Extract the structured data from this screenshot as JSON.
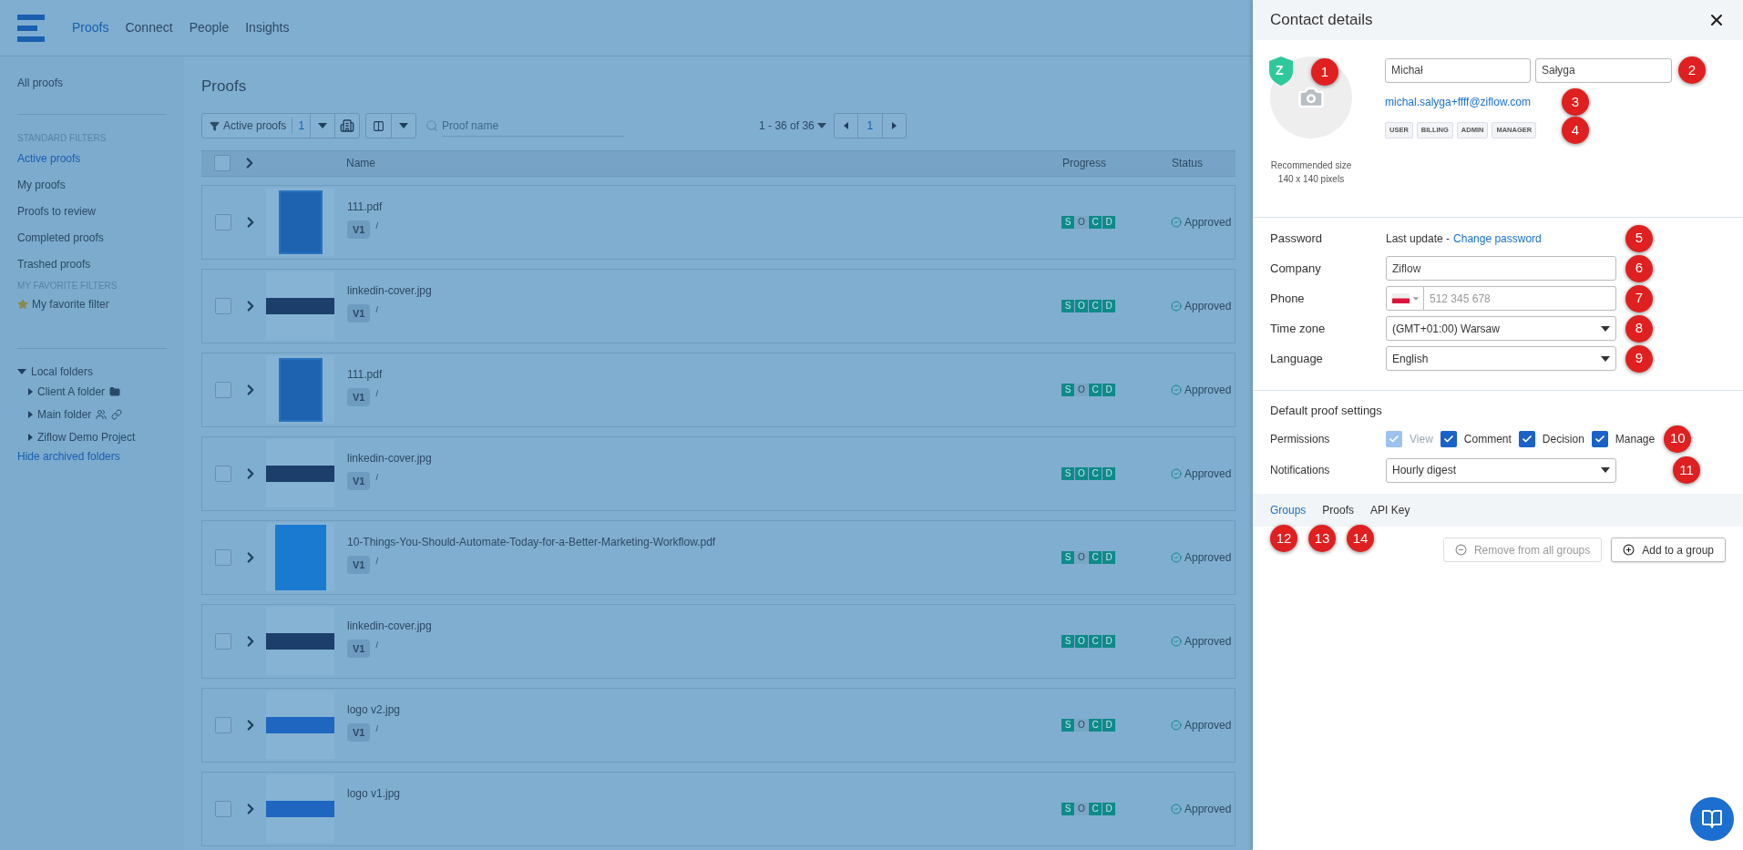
{
  "nav": {
    "items": [
      {
        "label": "Proofs",
        "selected": true
      },
      {
        "label": "Connect",
        "selected": false
      },
      {
        "label": "People",
        "selected": false
      },
      {
        "label": "Insights",
        "selected": false
      }
    ]
  },
  "sidebar": {
    "all_proofs": "All proofs",
    "standard_heading": "STANDARD FILTERS",
    "standard_items": [
      {
        "label": "Active proofs",
        "selected": true
      },
      {
        "label": "My proofs",
        "selected": false
      },
      {
        "label": "Proofs to review",
        "selected": false
      },
      {
        "label": "Completed proofs",
        "selected": false
      },
      {
        "label": "Trashed proofs",
        "selected": false
      }
    ],
    "favorite_heading": "MY FAVORITE FILTERS",
    "favorite_items": [
      {
        "label": "My favorite filter"
      }
    ],
    "folders": {
      "label": "Local folders",
      "expanded": true,
      "children": [
        {
          "label": "Client A folder",
          "kind": "client"
        },
        {
          "label": "Main folder",
          "kind": "shared"
        },
        {
          "label": "Ziflow Demo Project",
          "kind": "plain"
        }
      ]
    },
    "hide_archived": "Hide archived folders"
  },
  "main": {
    "title": "Proofs",
    "select_all": {
      "checked": false
    },
    "filter": {
      "label": "Active proofs",
      "count": "1"
    },
    "search": {
      "placeholder": "Proof name"
    },
    "pagination": {
      "range": "1 - 36 of 36",
      "page": "1"
    },
    "columns": [
      "Name",
      "Progress",
      "Status"
    ],
    "rows": [
      {
        "name": "111.pdf",
        "version": "V1",
        "path": "/",
        "checked": false,
        "kind": "poster",
        "steps": [
          {
            "letter": "S",
            "done": true
          },
          {
            "letter": "O",
            "done": false
          },
          {
            "letter": "C",
            "done": true
          },
          {
            "letter": "D",
            "done": true
          }
        ],
        "status": "Approved"
      },
      {
        "name": "linkedin-cover.jpg",
        "version": "V1",
        "path": "/",
        "checked": false,
        "kind": "banner",
        "steps": [
          {
            "letter": "S",
            "done": true
          },
          {
            "letter": "O",
            "done": true
          },
          {
            "letter": "C",
            "done": true
          },
          {
            "letter": "D",
            "done": true
          }
        ],
        "status": "Approved"
      },
      {
        "name": "111.pdf",
        "version": "V1",
        "path": "/",
        "checked": false,
        "kind": "poster",
        "steps": [
          {
            "letter": "S",
            "done": true
          },
          {
            "letter": "O",
            "done": false
          },
          {
            "letter": "C",
            "done": true
          },
          {
            "letter": "D",
            "done": true
          }
        ],
        "status": "Approved"
      },
      {
        "name": "linkedin-cover.jpg",
        "version": "V1",
        "path": "/",
        "checked": false,
        "kind": "banner",
        "steps": [
          {
            "letter": "S",
            "done": true
          },
          {
            "letter": "O",
            "done": true
          },
          {
            "letter": "C",
            "done": true
          },
          {
            "letter": "D",
            "done": true
          }
        ],
        "status": "Approved"
      },
      {
        "name": "10-Things-You-Should-Automate-Today-for-a-Better-Marketing-Workflow.pdf",
        "version": "V1",
        "path": "/",
        "checked": false,
        "kind": "ebook",
        "steps": [
          {
            "letter": "S",
            "done": true
          },
          {
            "letter": "O",
            "done": false
          },
          {
            "letter": "C",
            "done": true
          },
          {
            "letter": "D",
            "done": true
          }
        ],
        "status": "Approved"
      },
      {
        "name": "linkedin-cover.jpg",
        "version": "V1",
        "path": "/",
        "checked": false,
        "kind": "banner",
        "steps": [
          {
            "letter": "S",
            "done": true
          },
          {
            "letter": "O",
            "done": true
          },
          {
            "letter": "C",
            "done": true
          },
          {
            "letter": "D",
            "done": true
          }
        ],
        "status": "Approved"
      },
      {
        "name": "logo v2.jpg",
        "version": "V1",
        "path": "/",
        "checked": false,
        "kind": "logo",
        "steps": [
          {
            "letter": "S",
            "done": true
          },
          {
            "letter": "O",
            "done": false
          },
          {
            "letter": "C",
            "done": true
          },
          {
            "letter": "D",
            "done": true
          }
        ],
        "status": "Approved"
      },
      {
        "name": "logo v1.jpg",
        "checked": false,
        "kind": "logo",
        "steps": [
          {
            "letter": "S",
            "done": true
          },
          {
            "letter": "O",
            "done": false
          },
          {
            "letter": "C",
            "done": true
          },
          {
            "letter": "D",
            "done": true
          }
        ],
        "status": "Approved"
      }
    ]
  },
  "panel": {
    "title": "Contact details",
    "avatar": {
      "badge": "Z",
      "caption": "Recommended size 140 x 140 pixels",
      "marker": "1"
    },
    "first_name": "Michał",
    "last_name": {
      "value": "Sałyga",
      "marker": "2"
    },
    "email": {
      "text": "michal.salyga+ffff@ziflow.com",
      "marker": "3"
    },
    "roles": {
      "items": [
        "USER",
        "BILLING",
        "ADMIN",
        "MANAGER"
      ],
      "marker": "4"
    },
    "password": {
      "label": "Password",
      "text": "Last update -",
      "link": "Change password",
      "marker": "5"
    },
    "company": {
      "label": "Company",
      "value": "Ziflow",
      "marker": "6"
    },
    "phone": {
      "label": "Phone",
      "placeholder": "512 345 678",
      "marker": "7"
    },
    "time_zone": {
      "label": "Time zone",
      "value": "(GMT+01:00) Warsaw",
      "marker": "8"
    },
    "language": {
      "label": "Language",
      "value": "English",
      "marker": "9"
    },
    "defaults": {
      "heading": "Default proof settings",
      "permissions": {
        "label": "Permissions",
        "marker": "10",
        "options": [
          {
            "label": "View",
            "checked": true,
            "disabled": true
          },
          {
            "label": "Comment",
            "checked": true,
            "disabled": false
          },
          {
            "label": "Decision",
            "checked": true,
            "disabled": false
          },
          {
            "label": "Manage",
            "checked": true,
            "disabled": false
          }
        ]
      },
      "notifications": {
        "label": "Notifications",
        "value": "Hourly digest",
        "marker": "11"
      }
    },
    "tabs": [
      {
        "label": "Groups",
        "selected": true,
        "marker": "12"
      },
      {
        "label": "Proofs",
        "selected": false,
        "marker": "13"
      },
      {
        "label": "API Key",
        "selected": false,
        "marker": "14"
      }
    ],
    "buttons": [
      {
        "label": "Remove from all groups",
        "kind": "remove",
        "disabled": true
      },
      {
        "label": "Add to a group",
        "kind": "add",
        "disabled": false
      }
    ]
  }
}
